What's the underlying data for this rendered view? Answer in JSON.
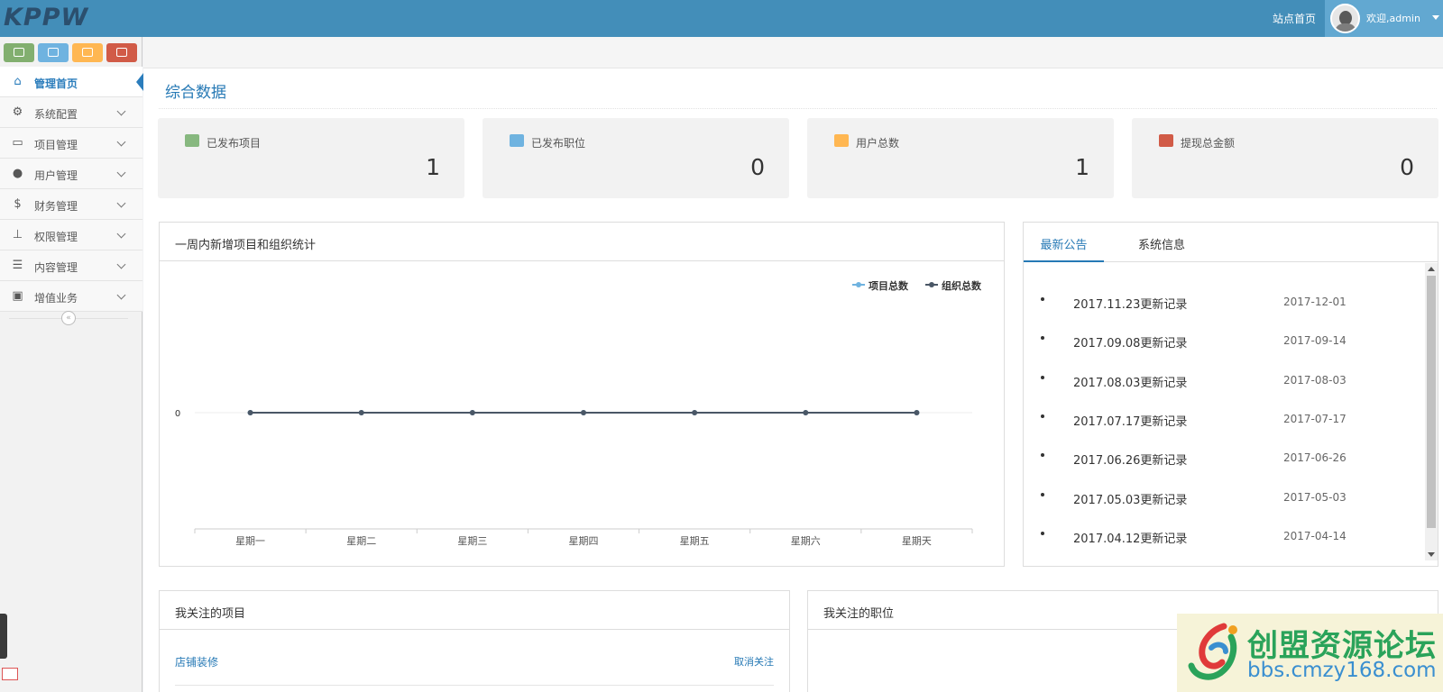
{
  "topbar": {
    "logo": "KPPW",
    "site_home": "站点首页",
    "welcome": "欢迎,admin"
  },
  "sidebar": {
    "shortcuts": [
      {
        "name": "monitor",
        "color": "#82af6f"
      },
      {
        "name": "money",
        "color": "#6fb3e0"
      },
      {
        "name": "user",
        "color": "#ffb752"
      },
      {
        "name": "settings",
        "color": "#d15b47"
      }
    ],
    "items": [
      {
        "label": "管理首页",
        "icon": "home-icon",
        "glyph": "⌂",
        "active": true
      },
      {
        "label": "系统配置",
        "icon": "gear-icon",
        "glyph": "⚙"
      },
      {
        "label": "项目管理",
        "icon": "laptop-icon",
        "glyph": "▭"
      },
      {
        "label": "用户管理",
        "icon": "users-icon",
        "glyph": "●"
      },
      {
        "label": "财务管理",
        "icon": "dollar-icon",
        "glyph": "$"
      },
      {
        "label": "权限管理",
        "icon": "sitemap-icon",
        "glyph": "⊥"
      },
      {
        "label": "内容管理",
        "icon": "list-icon",
        "glyph": "☰"
      },
      {
        "label": "增值业务",
        "icon": "briefcase-icon",
        "glyph": "▣"
      }
    ],
    "collapse_glyph": "«"
  },
  "page": {
    "title": "综合数据"
  },
  "stats": [
    {
      "label": "已发布项目",
      "value": "1",
      "icon": "files-icon",
      "color": "#87b87f"
    },
    {
      "label": "已发布职位",
      "value": "0",
      "icon": "briefcase-icon",
      "color": "#6fb3e0"
    },
    {
      "label": "用户总数",
      "value": "1",
      "icon": "users-icon",
      "color": "#ffb752"
    },
    {
      "label": "提现总金额",
      "value": "0",
      "icon": "credit-card-icon",
      "color": "#d15b47"
    }
  ],
  "chart_panel": {
    "title": "一周内新增项目和组织统计"
  },
  "chart_data": {
    "type": "line",
    "categories": [
      "星期一",
      "星期二",
      "星期三",
      "星期四",
      "星期五",
      "星期六",
      "星期天"
    ],
    "series": [
      {
        "name": "项目总数",
        "values": [
          0,
          0,
          0,
          0,
          0,
          0,
          0
        ],
        "color": "#6fb3e0"
      },
      {
        "name": "组织总数",
        "values": [
          0,
          0,
          0,
          0,
          0,
          0,
          0
        ],
        "color": "#4a5766"
      }
    ],
    "y_ticks": [
      "0"
    ],
    "legend": "top-right",
    "grid": true
  },
  "notices": {
    "tabs": [
      "最新公告",
      "系统信息"
    ],
    "items": [
      {
        "title": "2017.11.23更新记录",
        "date": "2017-12-01"
      },
      {
        "title": "2017.09.08更新记录",
        "date": "2017-09-14"
      },
      {
        "title": "2017.08.03更新记录",
        "date": "2017-08-03"
      },
      {
        "title": "2017.07.17更新记录",
        "date": "2017-07-17"
      },
      {
        "title": "2017.06.26更新记录",
        "date": "2017-06-26"
      },
      {
        "title": "2017.05.03更新记录",
        "date": "2017-05-03"
      },
      {
        "title": "2017.04.12更新记录",
        "date": "2017-04-14"
      }
    ]
  },
  "followed_projects": {
    "title": "我关注的项目",
    "items": [
      {
        "name": "店铺装修",
        "action": "取消关注"
      }
    ]
  },
  "followed_jobs": {
    "title": "我关注的职位"
  },
  "watermark": {
    "title": "创盟资源论坛",
    "url": "bbs.cmzy168.com"
  }
}
